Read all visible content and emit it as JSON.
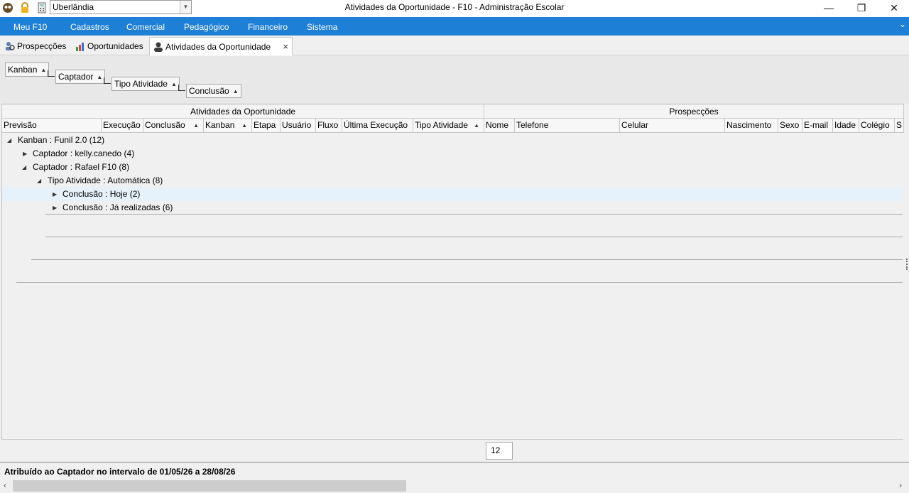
{
  "window": {
    "title": "Atividades da Oportunidade - F10 - Administração Escolar",
    "unit_select": "Uberlândia"
  },
  "menu": [
    "Meu F10",
    "Cadastros",
    "Comercial",
    "Pedagógico",
    "Financeiro",
    "Sistema"
  ],
  "tabs": [
    {
      "label": "Prospecções"
    },
    {
      "label": "Oportunidades"
    },
    {
      "label": "Atividades da Oportunidade",
      "close": "×"
    }
  ],
  "group_by": [
    "Kanban",
    "Captador",
    "Tipo Atividade",
    "Conclusão"
  ],
  "bands": [
    "Atividades da Oportunidade",
    "Prospecções"
  ],
  "columns": [
    "Previsão",
    "Execução",
    "Conclusão",
    "Kanban",
    "Etapa",
    "Usuário",
    "Fluxo",
    "Última Execução",
    "Tipo Atividade",
    "Nome",
    "Telefone",
    "Celular",
    "Nascimento",
    "Sexo",
    "E-mail",
    "Idade",
    "Colégio",
    "S"
  ],
  "tree": [
    "Kanban : Funil 2.0 (12)",
    "Captador : kelly.canedo (4)",
    "Captador : Rafael F10 (8)",
    "Tipo Atividade : Automática (8)",
    "Conclusão : Hoje (2)",
    "Conclusão : Já realizadas (6)"
  ],
  "summary_count": "12",
  "status_text": "Atribuído ao Captador no intervalo de 01/05/26 a 28/08/26"
}
